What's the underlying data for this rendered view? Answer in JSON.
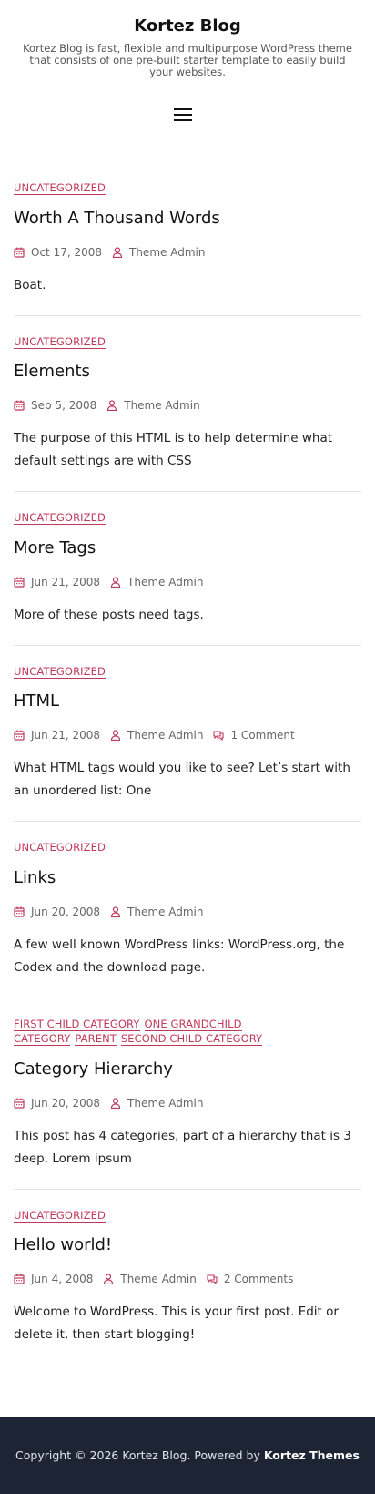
{
  "site": {
    "title": "Kortez Blog",
    "description": "Kortez Blog is fast, flexible and multipurpose WordPress theme that consists of one pre-built starter template to easily build your websites."
  },
  "colors": {
    "accent": "#c0395a",
    "footer_bg": "#1d2535"
  },
  "posts": [
    {
      "categories": [
        "UNCATEGORIZED"
      ],
      "title": "Worth A Thousand Words",
      "date": "Oct 17, 2008",
      "author": "Theme Admin",
      "comments": "",
      "excerpt": "Boat."
    },
    {
      "categories": [
        "UNCATEGORIZED"
      ],
      "title": "Elements",
      "date": "Sep 5, 2008",
      "author": "Theme Admin",
      "comments": "",
      "excerpt": "The purpose of this HTML is to help determine what default settings are with CSS"
    },
    {
      "categories": [
        "UNCATEGORIZED"
      ],
      "title": "More Tags",
      "date": "Jun 21, 2008",
      "author": "Theme Admin",
      "comments": "",
      "excerpt": "More of these posts need tags."
    },
    {
      "categories": [
        "UNCATEGORIZED"
      ],
      "title": "HTML",
      "date": "Jun 21, 2008",
      "author": "Theme Admin",
      "comments": "1 Comment",
      "excerpt": "What HTML tags would you like to see? Let’s start with an unordered list: One"
    },
    {
      "categories": [
        "UNCATEGORIZED"
      ],
      "title": "Links",
      "date": "Jun 20, 2008",
      "author": "Theme Admin",
      "comments": "",
      "excerpt": "A few well known WordPress links: WordPress.org, the Codex and the download page."
    },
    {
      "categories": [
        "FIRST CHILD CATEGORY",
        "ONE GRANDCHILD CATEGORY",
        "PARENT",
        "SECOND CHILD CATEGORY"
      ],
      "title": "Category Hierarchy",
      "date": "Jun 20, 2008",
      "author": "Theme Admin",
      "comments": "",
      "excerpt": "This post has 4 categories, part of a hierarchy that is 3 deep. Lorem ipsum"
    },
    {
      "categories": [
        "UNCATEGORIZED"
      ],
      "title": "Hello world!",
      "date": "Jun 4, 2008",
      "author": "Theme Admin",
      "comments": "2 Comments",
      "excerpt": "Welcome to WordPress. This is your first post. Edit or delete it, then start blogging!"
    }
  ],
  "footer": {
    "copyright": "Copyright © 2026 Kortez Blog. Powered by",
    "link": "Kortez Themes"
  },
  "icons": {
    "date": "calendar-icon",
    "author": "user-icon",
    "comments": "comment-icon",
    "menu": "hamburger-menu-icon"
  }
}
